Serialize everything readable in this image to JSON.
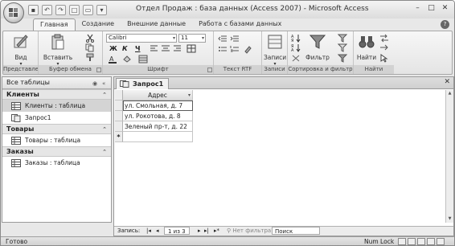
{
  "window": {
    "title": "Отдел Продаж : база данных (Access 2007) - Microsoft Access"
  },
  "qat": {
    "items": [
      "save-icon",
      "undo-icon",
      "redo-icon",
      "new-icon",
      "open-icon",
      "customize-icon"
    ]
  },
  "tabs": [
    "Главная",
    "Создание",
    "Внешние данные",
    "Работа с базами данных"
  ],
  "ribbon": {
    "views": {
      "button": "Вид",
      "label": "Представления"
    },
    "clipboard": {
      "button": "Вставить",
      "label": "Буфер обмена"
    },
    "font": {
      "family": "Calibri",
      "size": "11",
      "bold": "Ж",
      "italic": "К",
      "underline": "Ч",
      "label": "Шрифт"
    },
    "rtf": {
      "label": "Текст RTF"
    },
    "records": {
      "button": "Записи",
      "label": "Записи"
    },
    "sort": {
      "button": "Фильтр",
      "label": "Сортировка и фильтр"
    },
    "find": {
      "button": "Найти",
      "label": "Найти"
    }
  },
  "nav": {
    "header": "Все таблицы",
    "groups": [
      {
        "name": "Клиенты",
        "items": [
          "Клиенты : таблица",
          "Запрос1"
        ]
      },
      {
        "name": "Товары",
        "items": [
          "Товары : таблица"
        ]
      },
      {
        "name": "Заказы",
        "items": [
          "Заказы : таблица"
        ]
      }
    ]
  },
  "document": {
    "tab": "Запрос1",
    "column": "Адрес",
    "rows": [
      "ул. Смольная, д. 7",
      "ул. Рокотова, д. 8",
      "Зеленый пр-т, д. 22"
    ],
    "new_row_marker": "*"
  },
  "recnav": {
    "label": "Запись:",
    "position": "1 из 3",
    "filter": "Нет фильтра",
    "search": "Поиск"
  },
  "statusbar": {
    "left": "Готово",
    "numlock": "Num Lock"
  }
}
